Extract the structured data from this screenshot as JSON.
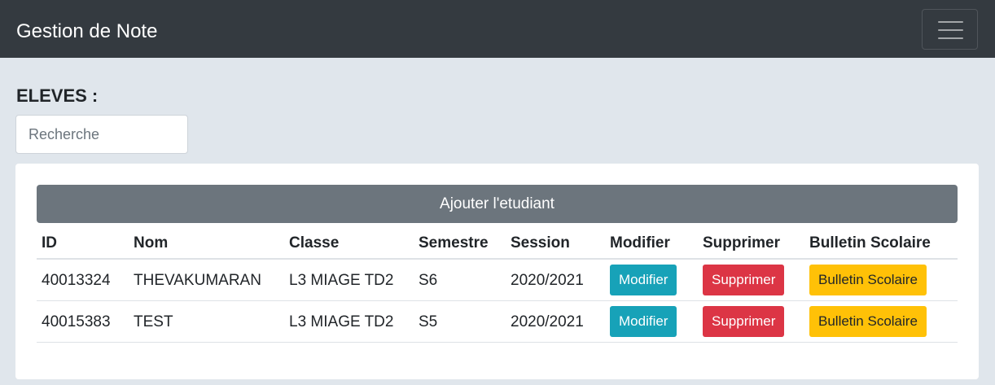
{
  "navbar": {
    "brand": "Gestion de Note",
    "toggler_icon": "hamburger-menu-icon"
  },
  "section": {
    "title": "ELEVES :"
  },
  "search": {
    "placeholder": "Recherche",
    "value": ""
  },
  "card": {
    "add_button_label": "Ajouter l'etudiant",
    "columns": [
      "ID",
      "Nom",
      "Classe",
      "Semestre",
      "Session",
      "Modifier",
      "Supprimer",
      "Bulletin Scolaire"
    ],
    "rows": [
      {
        "id": "40013324",
        "nom": "THEVAKUMARAN",
        "classe": "L3 MIAGE TD2",
        "semestre": "S6",
        "session": "2020/2021",
        "modifier_label": "Modifier",
        "supprimer_label": "Supprimer",
        "bulletin_label": "Bulletin Scolaire"
      },
      {
        "id": "40015383",
        "nom": "TEST",
        "classe": "L3 MIAGE TD2",
        "semestre": "S5",
        "session": "2020/2021",
        "modifier_label": "Modifier",
        "supprimer_label": "Supprimer",
        "bulletin_label": "Bulletin Scolaire"
      }
    ]
  },
  "colors": {
    "navbar": "#343a40",
    "page_background": "#e0e6ec",
    "secondary": "#6c757d",
    "info": "#17a2b8",
    "danger": "#dc3545",
    "warning": "#ffc107"
  }
}
